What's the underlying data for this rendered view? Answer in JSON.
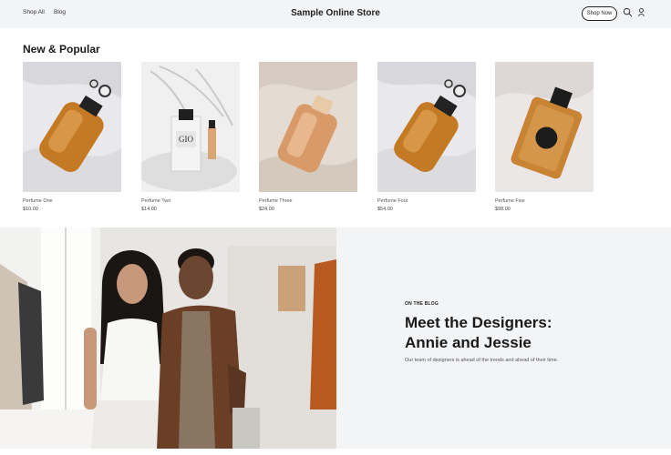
{
  "header": {
    "nav": [
      "Shop All",
      "Blog"
    ],
    "title": "Sample Online Store",
    "cta": "Shop Now",
    "icons": [
      "search-icon",
      "account-icon"
    ]
  },
  "section": {
    "title": "New & Popular"
  },
  "products": [
    {
      "name": "Perfume One",
      "price": "$10.00"
    },
    {
      "name": "Perfume Two",
      "price": "$14.00"
    },
    {
      "name": "Perfume Three",
      "price": "$24.00"
    },
    {
      "name": "Perfume Four",
      "price": "$54.00"
    },
    {
      "name": "Perfume Five",
      "price": "$98.00"
    }
  ],
  "blog": {
    "kicker": "ON THE BLOG",
    "headline_line1": "Meet the Designers:",
    "headline_line2": "Annie and Jessie",
    "blurb": "Our team of designers is ahead of the trends and ahead of their time."
  },
  "colors": {
    "header_bg": "#f3f4f6",
    "text": "#222222"
  }
}
